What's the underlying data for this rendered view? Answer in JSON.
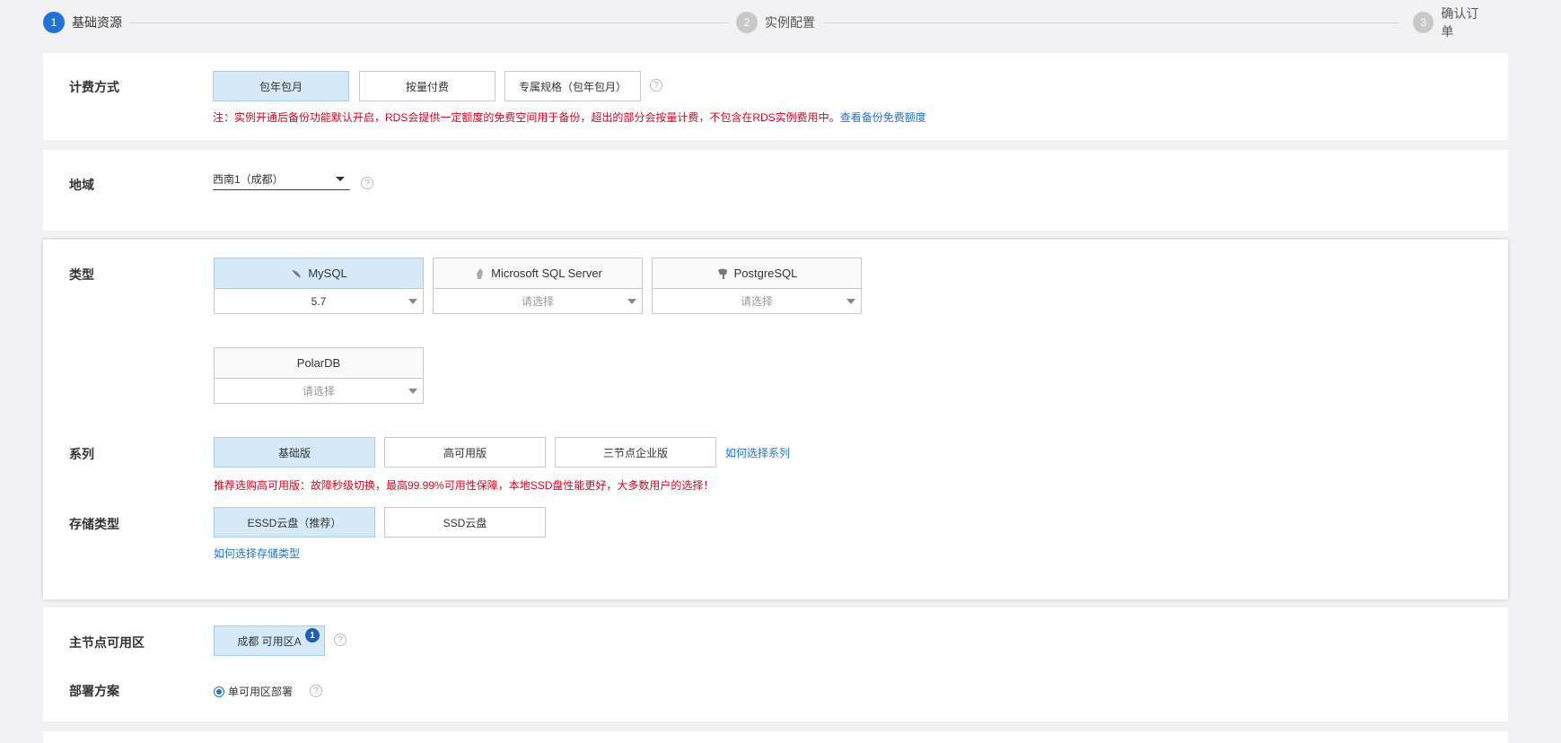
{
  "steps": [
    {
      "num": "1",
      "label": "基础资源"
    },
    {
      "num": "2",
      "label": "实例配置"
    },
    {
      "num": "3",
      "label": "确认订单"
    }
  ],
  "billing": {
    "label": "计费方式",
    "options": [
      "包年包月",
      "按量付费",
      "专属规格（包年包月）"
    ],
    "note": "注：实例开通后备份功能默认开启，RDS会提供一定额度的免费空间用于备份，超出的部分会按量计费，不包含在RDS实例费用中。",
    "note_link": "查看备份免费额度"
  },
  "region": {
    "label": "地域",
    "value": "西南1（成都）"
  },
  "type": {
    "label": "类型",
    "engines": [
      {
        "name": "MySQL",
        "version": "5.7"
      },
      {
        "name": "Microsoft SQL Server",
        "version": "请选择"
      },
      {
        "name": "PostgreSQL",
        "version": "请选择"
      },
      {
        "name": "PolarDB",
        "version": "请选择"
      }
    ]
  },
  "series": {
    "label": "系列",
    "options": [
      "基础版",
      "高可用版",
      "三节点企业版"
    ],
    "help_link": "如何选择系列",
    "note": "推荐选购高可用版：故障秒级切换，最高99.99%可用性保障，本地SSD盘性能更好，大多数用户的选择！"
  },
  "storage": {
    "label": "存储类型",
    "options": [
      "ESSD云盘（推荐）",
      "SSD云盘"
    ],
    "help_link": "如何选择存储类型"
  },
  "zone": {
    "label": "主节点可用区",
    "value": "成都 可用区A",
    "badge": "1"
  },
  "deploy": {
    "label": "部署方案",
    "value": "单可用区部署"
  },
  "help_mark": "?"
}
